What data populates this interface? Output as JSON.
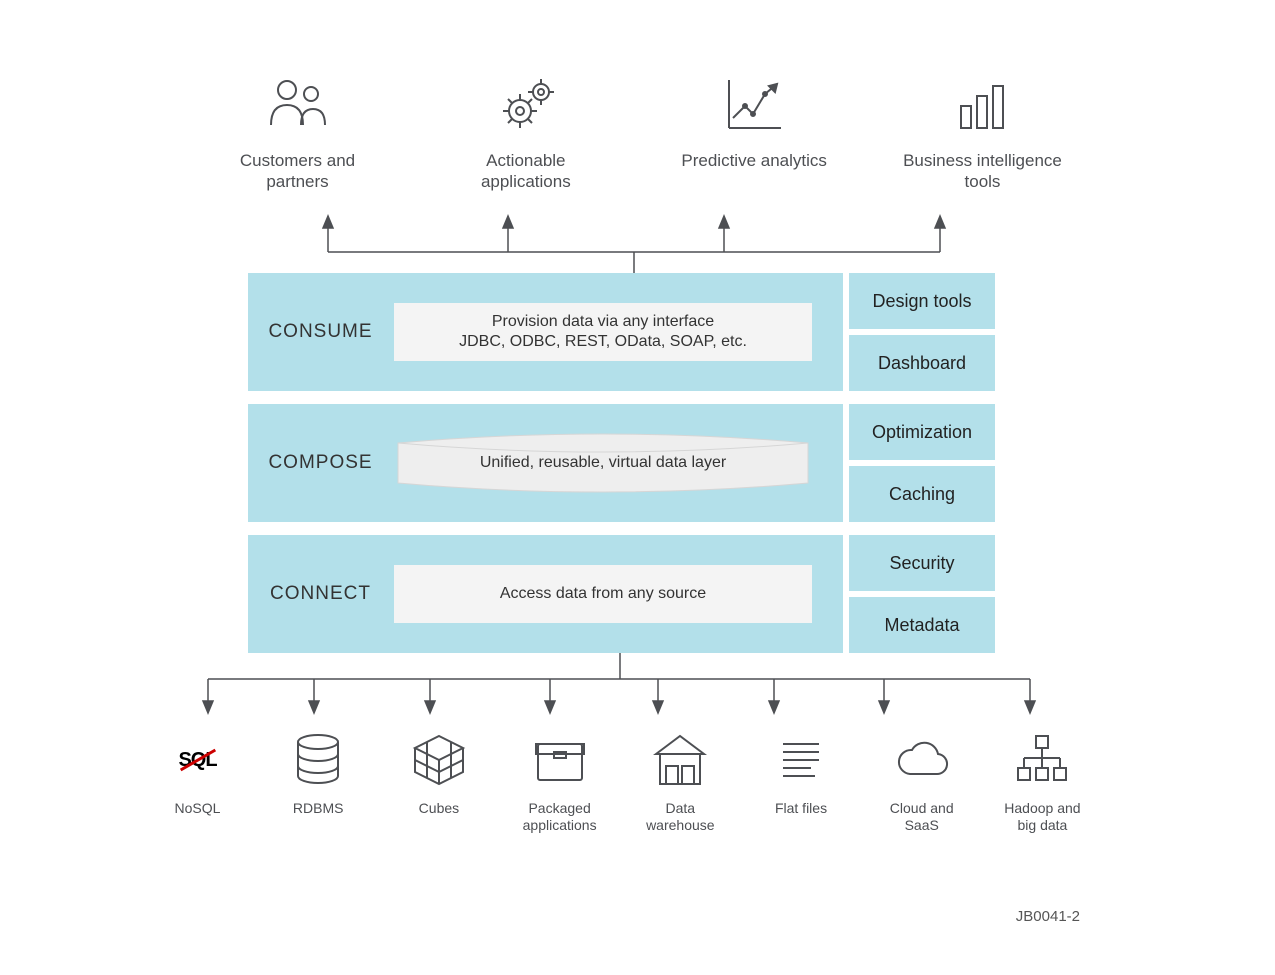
{
  "consumers": [
    {
      "label": "Customers and\npartners",
      "icon": "people-icon"
    },
    {
      "label": "Actionable\napplications",
      "icon": "gear-icon"
    },
    {
      "label": "Predictive analytics",
      "icon": "chart-icon"
    },
    {
      "label": "Business intelligence\ntools",
      "icon": "bi-icon"
    }
  ],
  "rows": [
    {
      "label": "CONSUME",
      "body_line1": "Provision data via any interface",
      "body_line2": "JDBC, ODBC, REST, OData, SOAP, etc.",
      "style": "box",
      "side": [
        "Design tools",
        "Dashboard"
      ]
    },
    {
      "label": "COMPOSE",
      "body_line1": "Unified, reusable, virtual data layer",
      "body_line2": "",
      "style": "disc",
      "side": [
        "Optimization",
        "Caching"
      ]
    },
    {
      "label": "CONNECT",
      "body_line1": "Access data from any source",
      "body_line2": "",
      "style": "box",
      "side": [
        "Security",
        "Metadata"
      ]
    }
  ],
  "sources": [
    {
      "label": "NoSQL",
      "icon": "nosql-icon"
    },
    {
      "label": "RDBMS",
      "icon": "db-icon"
    },
    {
      "label": "Cubes",
      "icon": "cube-icon"
    },
    {
      "label": "Packaged\napplications",
      "icon": "packaged-icon"
    },
    {
      "label": "Data\nwarehouse",
      "icon": "warehouse-icon"
    },
    {
      "label": "Flat files",
      "icon": "files-icon"
    },
    {
      "label": "Cloud and\nSaaS",
      "icon": "cloud-icon"
    },
    {
      "label": "Hadoop and\nbig data",
      "icon": "hadoop-icon"
    }
  ],
  "footer_id": "JB0041-2",
  "colors": {
    "panel": "#b3e0ea",
    "box": "#f4f4f4",
    "text": "#4d4f53",
    "accent": "#cc0000"
  }
}
